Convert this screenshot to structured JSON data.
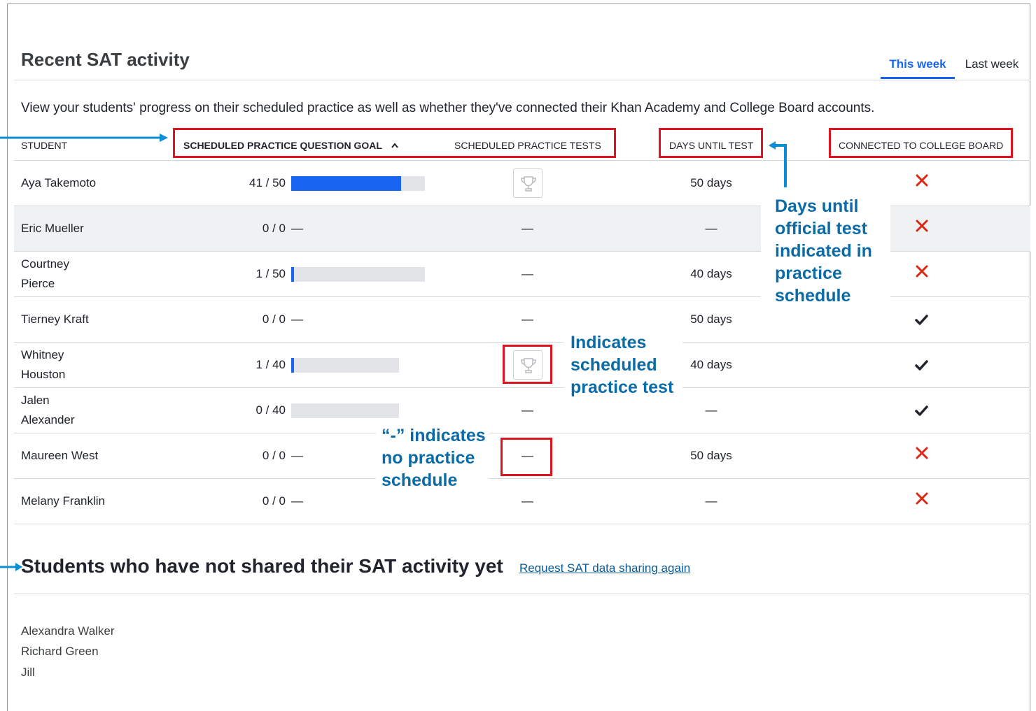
{
  "header": {
    "title": "Recent SAT activity",
    "tabs": [
      {
        "label": "This week",
        "active": true
      },
      {
        "label": "Last week",
        "active": false
      }
    ]
  },
  "description": "View your students' progress on their scheduled practice as well as whether they've connected their Khan Academy and College Board accounts.",
  "table": {
    "columns": {
      "student": "STUDENT",
      "goal": "SCHEDULED PRACTICE QUESTION GOAL",
      "tests": "SCHEDULED PRACTICE TESTS",
      "days": "DAYS UNTIL TEST",
      "connected": "CONNECTED TO COLLEGE BOARD"
    },
    "sort_icon": "chevron-up-icon",
    "rows": [
      {
        "name": "Aya Takemoto",
        "goal": "41 / 50",
        "progress": 0.82,
        "track": "long",
        "test": "trophy",
        "days": "50 days",
        "connected": false
      },
      {
        "name": "Eric Mueller",
        "goal": "0 / 0",
        "goal_dash": "—",
        "progress": null,
        "test": "—",
        "days": "—",
        "connected": false
      },
      {
        "name": "Courtney\nPierce",
        "goal": "1 / 50",
        "progress": 0.02,
        "track": "long",
        "test": "—",
        "days": "40 days",
        "connected": false
      },
      {
        "name": "Tierney Kraft",
        "goal": "0 / 0",
        "goal_dash": "—",
        "progress": null,
        "test": "—",
        "days": "50 days",
        "connected": true
      },
      {
        "name": "Whitney\nHouston",
        "goal": "1 / 40",
        "progress": 0.025,
        "track": "short",
        "test": "trophy",
        "days": "40 days",
        "connected": true
      },
      {
        "name": "Jalen\nAlexander",
        "goal": "0 / 40",
        "progress": 0,
        "track": "short",
        "test": "—",
        "days": "—",
        "connected": true
      },
      {
        "name": "Maureen West",
        "goal": "0 / 0",
        "goal_dash": "—",
        "progress": null,
        "test": "—",
        "days": "50 days",
        "connected": false
      },
      {
        "name": "Melany Franklin",
        "goal": "0 / 0",
        "goal_dash": "—",
        "progress": null,
        "test": "—",
        "days": "—",
        "connected": false
      }
    ]
  },
  "annotations": {
    "days": "Days until\nofficial test\nindicated in\npractice\nschedule",
    "trophy": "Indicates\nscheduled\npractice test",
    "dash": "“-” indicates\nno practice\nschedule"
  },
  "not_shared": {
    "title": "Students who have not shared their SAT activity yet",
    "link": "Request SAT data sharing again",
    "students": [
      "Alexandra Walker",
      "Richard Green",
      "Jill"
    ]
  },
  "colors": {
    "accent": "#1865f2",
    "annotation": "#0a6ba6",
    "highlight": "#e0141e",
    "x_mark": "#d92916"
  }
}
